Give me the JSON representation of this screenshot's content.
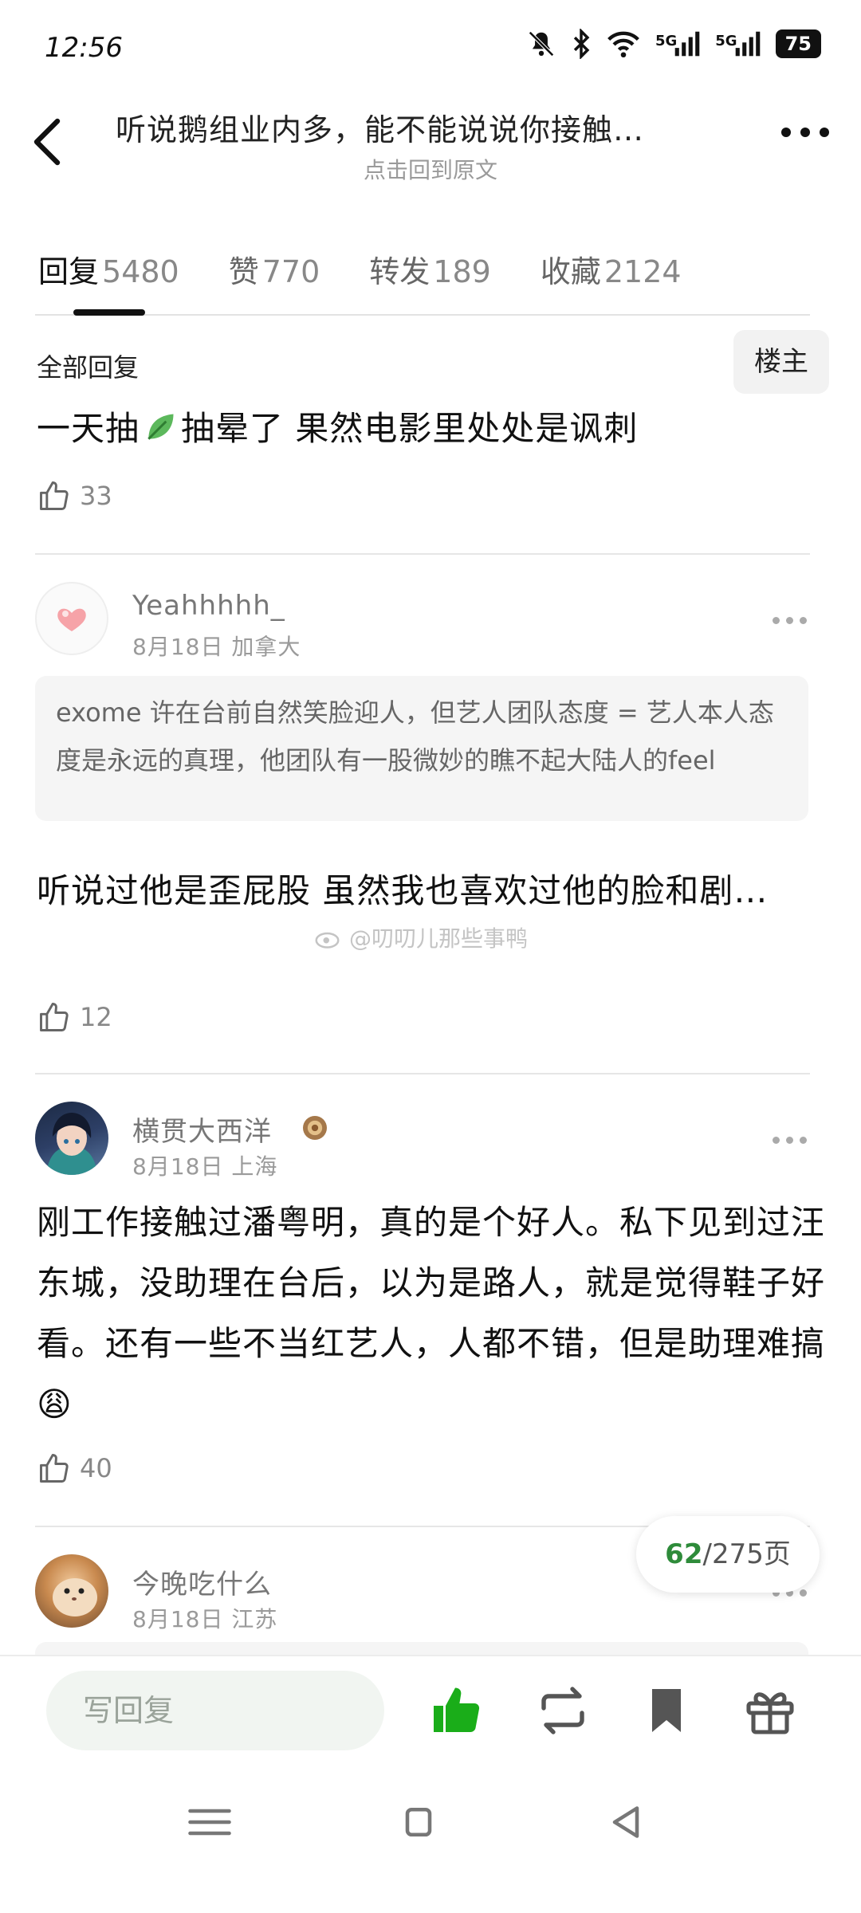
{
  "status_bar": {
    "time": "12:56",
    "signal1": "5G",
    "signal2": "5G",
    "battery": "75"
  },
  "header": {
    "title": "听说鹅组业内多，能不能说说你接触…",
    "subtitle": "点击回到原文"
  },
  "tabs": [
    {
      "label": "回复",
      "count": "5480"
    },
    {
      "label": "赞",
      "count": "770"
    },
    {
      "label": "转发",
      "count": "189"
    },
    {
      "label": "收藏",
      "count": "2124"
    }
  ],
  "replies_section": {
    "title": "全部回复",
    "op_button": "楼主"
  },
  "op_post": {
    "text_before": "一天抽",
    "text_after": "抽晕了 果然电影里处处是讽刺",
    "likes": "33"
  },
  "comments": [
    {
      "username": "Yeahhhhh_",
      "date": "8月18日",
      "location": "加拿大",
      "quote": "exome 许在台前自然笑脸迎人，但艺人团队态度 = 艺人本人态度是永远的真理，他团队有一股微妙的瞧不起大陆人的feel",
      "text": "听说过他是歪屁股 虽然我也喜欢过他的脸和剧…",
      "likes": "12"
    },
    {
      "username": "横贯大西洋",
      "date": "8月18日",
      "location": "上海",
      "text": "刚工作接触过潘粤明，真的是个好人。私下见到过汪东城，没助理在台后，以为是路人，就是觉得鞋子好看。还有一些不当红艺人，人都不错，但是助理难搞😩",
      "likes": "40"
    },
    {
      "username": "今晚吃什么",
      "date": "8月18日",
      "location": "江苏"
    }
  ],
  "watermark": "@叨叨儿那些事鸭",
  "page_indicator": {
    "current": "62",
    "total": "/275页"
  },
  "bottom_bar": {
    "reply_placeholder": "写回复"
  },
  "colors": {
    "accent_green": "#2e8b3a",
    "like_green": "#1aad19"
  }
}
